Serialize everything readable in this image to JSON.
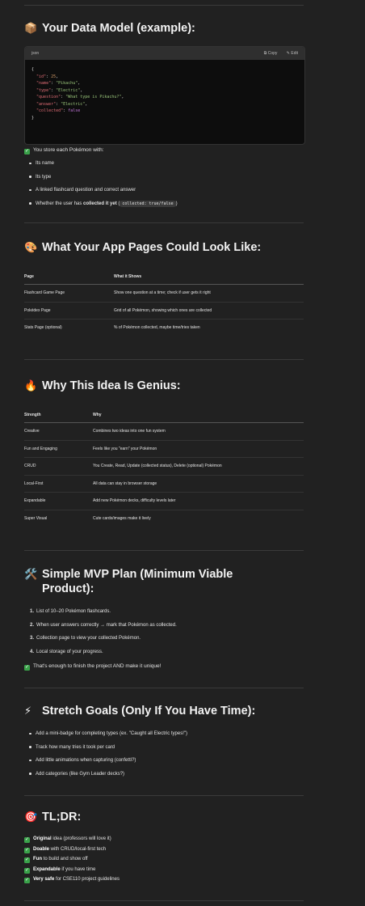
{
  "section1": {
    "emoji": "📦",
    "title": "Your Data Model (example):",
    "code": {
      "lang": "json",
      "copy_label": "⧉ Copy",
      "edit_label": "✎ Edit",
      "lines": [
        {
          "key": "\"id\"",
          "val": "25",
          "kind": "n"
        },
        {
          "key": "\"name\"",
          "val": "\"Pikachu\"",
          "kind": "s"
        },
        {
          "key": "\"type\"",
          "val": "\"Electric\"",
          "kind": "s"
        },
        {
          "key": "\"question\"",
          "val": "\"What type is Pikachu?\"",
          "kind": "s"
        },
        {
          "key": "\"answer\"",
          "val": "\"Electric\"",
          "kind": "s"
        },
        {
          "key": "\"collected\"",
          "val": "false",
          "kind": "b"
        }
      ]
    },
    "stored_text": "You store each Pokémon with:",
    "bullets": [
      "Its name",
      "Its type",
      "A linked flashcard question and correct answer"
    ],
    "last_bullet_prefix": "Whether the user has ",
    "last_bullet_bold": "collected it yet",
    "last_bullet_code": "collected: true/false"
  },
  "section2": {
    "emoji": "🎨",
    "title": "What Your App Pages Could Look Like:",
    "headers": [
      "Page",
      "What it Shows"
    ],
    "rows": [
      [
        "Flashcard Game Page",
        "Show one question at a time; check if user gets it right"
      ],
      [
        "Pokédex Page",
        "Grid of all Pokémon, showing which ones are collected"
      ],
      [
        "Stats Page (optional)",
        "% of Pokémon collected, maybe time/tries taken"
      ]
    ]
  },
  "section3": {
    "emoji": "🔥",
    "title": "Why This Idea Is Genius:",
    "headers": [
      "Strength",
      "Why"
    ],
    "rows": [
      [
        "Creative",
        "Combines two ideas into one fun system"
      ],
      [
        "Fun and Engaging",
        "Feels like you \"earn\" your Pokémon"
      ],
      [
        "CRUD",
        "You Create, Read, Update (collected status), Delete (optional) Pokémon"
      ],
      [
        "Local-First",
        "All data can stay in browser storage"
      ],
      [
        "Expandable",
        "Add new Pokémon decks, difficulty levels later"
      ],
      [
        "Super Visual",
        "Cute cards/images make it lively"
      ]
    ]
  },
  "section4": {
    "emoji": "🛠️",
    "title_line1": "Simple MVP Plan (Minimum Viable",
    "title_line2": "Product):",
    "items": [
      "List of 10–20 Pokémon flashcards.",
      "When user answers correctly → mark that Pokémon as collected.",
      "Collection page to view your collected Pokémon.",
      "Local storage of your progress."
    ],
    "enough_text": "That's enough to finish the project AND make it unique!"
  },
  "section5": {
    "emoji": "⚡",
    "title": "Stretch Goals (Only If You Have Time):",
    "bullets": [
      "Add a mini-badge for completing types (ex. \"Caught all Electric types!\")",
      "Track how many tries it took per card",
      "Add little animations when capturing (confetti?)",
      "Add categories (like Gym Leader decks?)"
    ]
  },
  "section6": {
    "emoji": "🎯",
    "title": "TL;DR:",
    "rows": [
      {
        "bold": "Original",
        "rest": " idea (professors will love it)"
      },
      {
        "bold": "Doable",
        "rest": " with CRUD/local-first tech"
      },
      {
        "bold": "Fun",
        "rest": " to build and show off"
      },
      {
        "bold": "Expandable",
        "rest": " if you have time"
      },
      {
        "bold": "Very safe",
        "rest": " for CSE110 project guidelines"
      }
    ]
  }
}
